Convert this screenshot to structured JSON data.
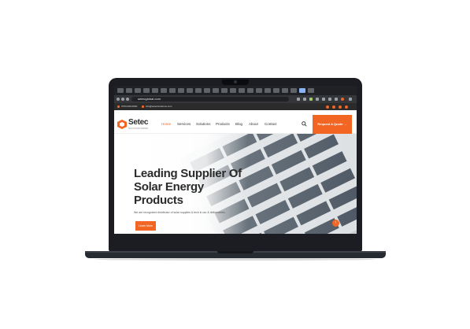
{
  "browser": {
    "url": "setecglobal.com"
  },
  "topbar": {
    "phone": "0703-000-0000",
    "email": "info@setecsolutions.com"
  },
  "header": {
    "brand": "Setec",
    "brand_tagline": "SOLUTIONS LIMITED",
    "nav": [
      "Home",
      "Services",
      "Solutions",
      "Products",
      "Blog",
      "About",
      "Contact"
    ],
    "active_nav": "Home",
    "quote_button": "Request A Quote →"
  },
  "hero": {
    "title_lines": [
      "Leading Supplier Of",
      "Solar Energy",
      "Products"
    ],
    "subtitle": "We are recognized distributor of solar supplies & tech in our & deliverables.",
    "cta": "Learn More",
    "scroll_icon": "↑"
  },
  "colors": {
    "accent": "#f26522",
    "dark": "#2b2b2b",
    "laptop_body": "#1b1d22"
  },
  "icons": [
    "search-icon",
    "setec-logo-icon",
    "phone-icon",
    "email-icon",
    "facebook-icon",
    "twitter-icon",
    "linkedin-icon",
    "instagram-icon",
    "scroll-up-icon"
  ]
}
